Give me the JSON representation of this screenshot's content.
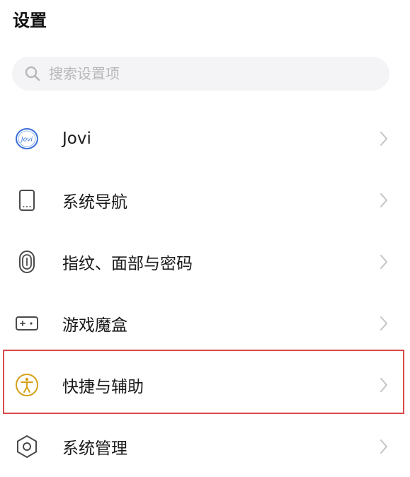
{
  "header": {
    "title": "设置"
  },
  "search": {
    "placeholder": "搜索设置项",
    "icon": "search-icon"
  },
  "settings": {
    "items": [
      {
        "label": "Jovi",
        "icon": "jovi-icon",
        "icon_text": "Jovi"
      },
      {
        "label": "系统导航",
        "icon": "phone-navigation-icon"
      },
      {
        "label": "指纹、面部与密码",
        "icon": "fingerprint-icon"
      },
      {
        "label": "游戏魔盒",
        "icon": "game-box-icon"
      },
      {
        "label": "快捷与辅助",
        "icon": "accessibility-icon"
      },
      {
        "label": "系统管理",
        "icon": "hexagon-settings-icon"
      }
    ]
  },
  "annotation": {
    "highlighted_item": "快捷与辅助",
    "highlight_color": "#d94a4a"
  },
  "colors": {
    "jovi_blue": "#3a6fd8",
    "accessibility_gold": "#d4a017",
    "icon_gray": "#4a4a4a",
    "chevron_gray": "#c4c4c4",
    "search_bg": "#f4f4f6"
  }
}
